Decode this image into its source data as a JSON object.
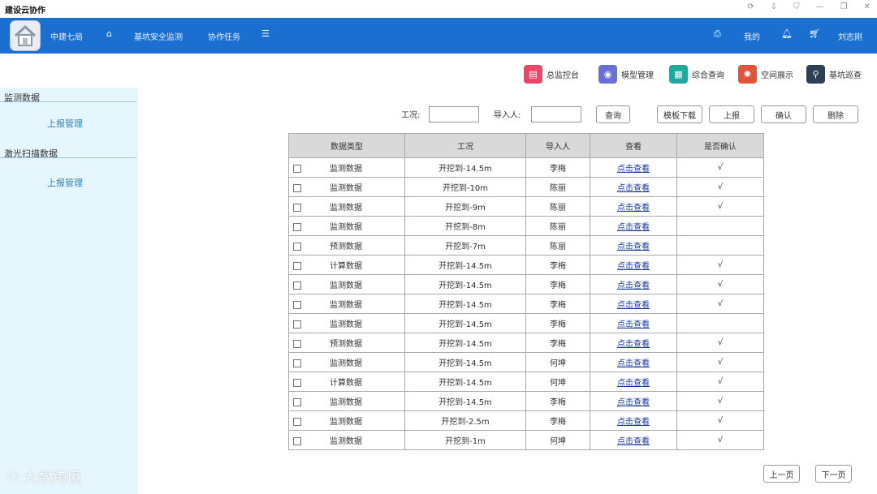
{
  "window": {
    "title": "建设云协作",
    "controls": [
      "⟳",
      "⇩",
      "⛉",
      "—",
      "❐",
      "✕"
    ]
  },
  "navbar": {
    "org": "中建七局",
    "menu": [
      "基坑安全监测",
      "协作任务"
    ],
    "right": {
      "mine": "我的",
      "user": "刘志刚"
    }
  },
  "quick_buttons": [
    {
      "label": "总监控台",
      "color": "#e8476a"
    },
    {
      "label": "模型管理",
      "color": "#6a6fd8"
    },
    {
      "label": "综合查询",
      "color": "#20a89e"
    },
    {
      "label": "空间展示",
      "color": "#e0553a"
    },
    {
      "label": "基坑巡查",
      "color": "#2d3f55"
    }
  ],
  "sidebar": {
    "groups": [
      {
        "title": "监测数据",
        "link": "上报管理"
      },
      {
        "title": "激光扫描数据",
        "link": "上报管理"
      }
    ]
  },
  "filters": {
    "condition_label": "工况:",
    "importer_label": "导入人:",
    "condition_value": "",
    "importer_value": ""
  },
  "buttons": {
    "query": "查询",
    "template_download": "模板下载",
    "report": "上报",
    "confirm": "确认",
    "delete": "删除",
    "prev_page": "上一页",
    "next_page": "下一页"
  },
  "table": {
    "headers": [
      "数据类型",
      "工况",
      "导入人",
      "查看",
      "是否确认"
    ],
    "rows": [
      {
        "type": "监测数据",
        "condition": "开挖到-14.5m",
        "importer": "李梅",
        "view": "点击查看",
        "confirmed": "√"
      },
      {
        "type": "监测数据",
        "condition": "开挖到-10m",
        "importer": "陈丽",
        "view": "点击查看",
        "confirmed": "√"
      },
      {
        "type": "监测数据",
        "condition": "开挖到-9m",
        "importer": "陈丽",
        "view": "点击查看",
        "confirmed": "√"
      },
      {
        "type": "监测数据",
        "condition": "开挖到-8m",
        "importer": "陈丽",
        "view": "点击查看",
        "confirmed": ""
      },
      {
        "type": "预测数据",
        "condition": "开挖到-7m",
        "importer": "陈丽",
        "view": "点击查看",
        "confirmed": ""
      },
      {
        "type": "计算数据",
        "condition": "开挖到-14.5m",
        "importer": "李梅",
        "view": "点击查看",
        "confirmed": "√"
      },
      {
        "type": "监测数据",
        "condition": "开挖到-14.5m",
        "importer": "李梅",
        "view": "点击查看",
        "confirmed": "√"
      },
      {
        "type": "监测数据",
        "condition": "开挖到-14.5m",
        "importer": "李梅",
        "view": "点击查看",
        "confirmed": "√"
      },
      {
        "type": "监测数据",
        "condition": "开挖到-14.5m",
        "importer": "李梅",
        "view": "点击查看",
        "confirmed": ""
      },
      {
        "type": "预测数据",
        "condition": "开挖到-14.5m",
        "importer": "李梅",
        "view": "点击查看",
        "confirmed": "√"
      },
      {
        "type": "监测数据",
        "condition": "开挖到-14.5m",
        "importer": "何坤",
        "view": "点击查看",
        "confirmed": "√"
      },
      {
        "type": "计算数据",
        "condition": "开挖到-14.5m",
        "importer": "何坤",
        "view": "点击查看",
        "confirmed": "√"
      },
      {
        "type": "监测数据",
        "condition": "开挖到-14.5m",
        "importer": "李梅",
        "view": "点击查看",
        "confirmed": "√"
      },
      {
        "type": "监测数据",
        "condition": "开挖到-2.5m",
        "importer": "李梅",
        "view": "点击查看",
        "confirmed": "√"
      },
      {
        "type": "监测数据",
        "condition": "开挖到-1m",
        "importer": "何坤",
        "view": "点击查看",
        "confirmed": "√"
      }
    ]
  },
  "watermark": "大数跨境"
}
